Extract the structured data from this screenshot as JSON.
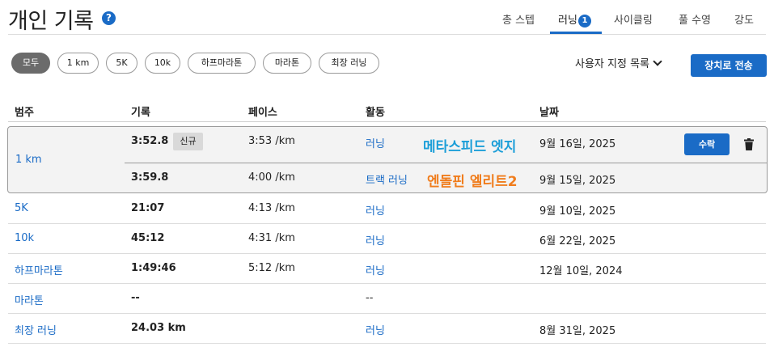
{
  "page": {
    "title": "개인 기록"
  },
  "tabs": [
    {
      "label": "총 스텝"
    },
    {
      "label": "러닝",
      "badge": "1",
      "active": true
    },
    {
      "label": "사이클링"
    },
    {
      "label": "풀 수영"
    },
    {
      "label": "강도"
    }
  ],
  "filters": [
    "모두",
    "1 km",
    "5K",
    "10k",
    "하프마라톤",
    "마라톤",
    "최장 러닝"
  ],
  "active_filter": "모두",
  "custom_list_label": "사용자 지정 목록",
  "send_to_device_label": "장치로 전송",
  "columns": [
    "범주",
    "기록",
    "페이스",
    "활동",
    "날짜"
  ],
  "group": {
    "category": "1 km",
    "entries": [
      {
        "record": "3:52.8",
        "badge": "신규",
        "pace": "3:53 /km",
        "activity": "러닝",
        "annotation": "메타스피드 엣지",
        "date": "9월 16일, 2025",
        "accept_label": "수락"
      },
      {
        "record": "3:59.8",
        "pace": "4:00 /km",
        "activity": "트랙 러닝",
        "annotation": "엔돌핀 엘리트2",
        "date": "9월 15일, 2025"
      }
    ]
  },
  "rows": [
    {
      "category": "5K",
      "record": "21:07",
      "pace": "4:13 /km",
      "activity": "러닝",
      "date": "9월 10일, 2025"
    },
    {
      "category": "10k",
      "record": "45:12",
      "pace": "4:31 /km",
      "activity": "러닝",
      "date": "6월 22일, 2025"
    },
    {
      "category": "하프마라톤",
      "record": "1:49:46",
      "pace": "5:12 /km",
      "activity": "러닝",
      "date": "12월 10일, 2024"
    },
    {
      "category": "마라톤",
      "record": "--",
      "pace": "",
      "activity": "--",
      "date": ""
    },
    {
      "category": "최장 러닝",
      "record": "24.03 km",
      "pace": "",
      "activity": "러닝",
      "date": "8월 31일, 2025"
    }
  ],
  "icons": {
    "help": "help-circle-icon",
    "chevron": "chevron-down-icon",
    "delete": "trash-icon",
    "accent": "#1a6bc6"
  }
}
